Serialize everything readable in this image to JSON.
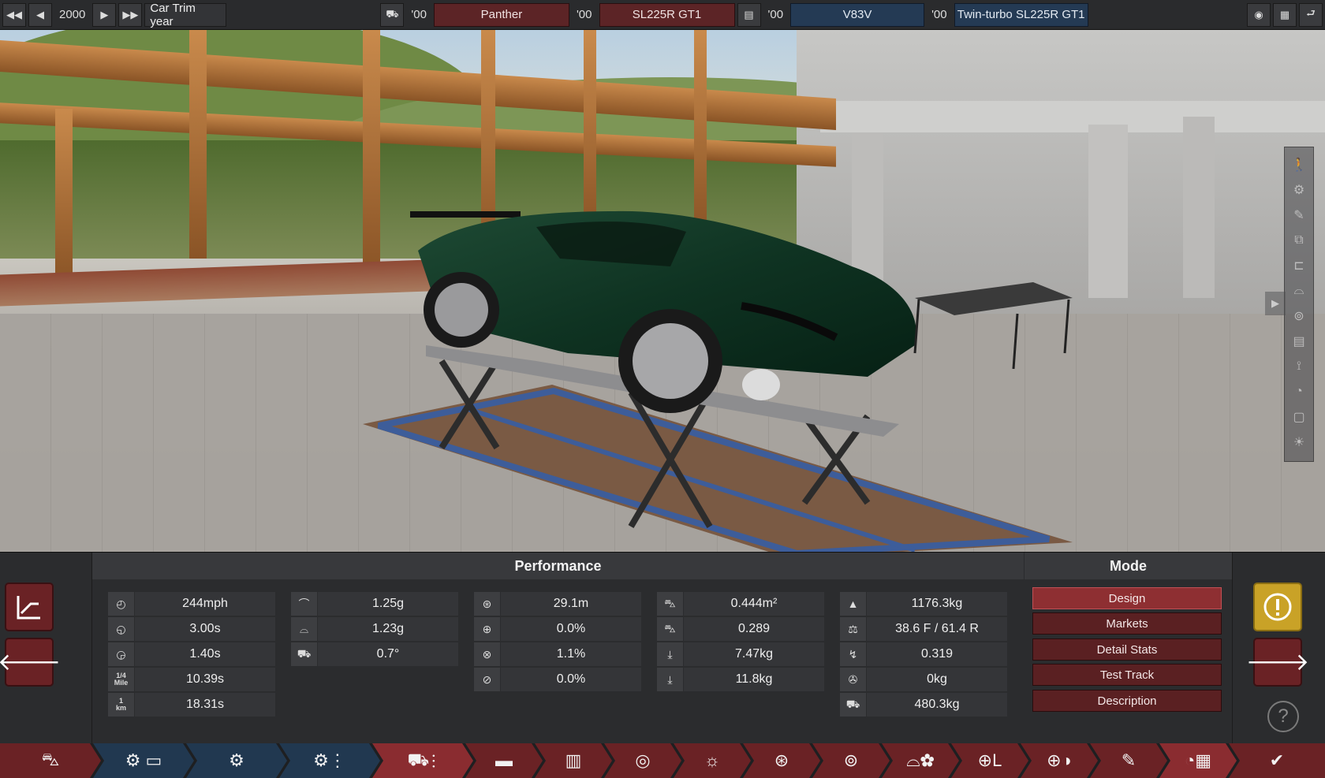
{
  "topbar": {
    "year": "2000",
    "year_label": "Car Trim year",
    "model_year": "'00",
    "model_name": "Panther",
    "trim_year": "'00",
    "trim_name": "SL225R GT1",
    "engine_year": "'00",
    "engine_name": "V83V",
    "variant_year": "'00",
    "variant_name": "Twin-turbo SL225R GT1"
  },
  "panel": {
    "performance_title": "Performance",
    "mode_title": "Mode"
  },
  "stats": {
    "col1": [
      {
        "icon": "speedometer-icon",
        "value": "244mph"
      },
      {
        "icon": "acceleration-icon",
        "value": "3.00s"
      },
      {
        "icon": "gauge-icon",
        "value": "1.40s"
      },
      {
        "icon": "quarter-mile-icon",
        "label_top": "1/4",
        "label_bottom": "Mile",
        "value": "10.39s"
      },
      {
        "icon": "km-icon",
        "label_top": "1",
        "label_bottom": "km",
        "value": "18.31s"
      }
    ],
    "col2": [
      {
        "icon": "corner-grip-icon",
        "value": "1.25g"
      },
      {
        "icon": "corner-grip-alt-icon",
        "value": "1.23g"
      },
      {
        "icon": "body-roll-icon",
        "value": "0.7°"
      }
    ],
    "col3": [
      {
        "icon": "brake-disc-icon",
        "value": "29.1m"
      },
      {
        "icon": "brake-fade-icon",
        "value": "0.0%"
      },
      {
        "icon": "brake-cool-icon",
        "value": "1.1%"
      },
      {
        "icon": "brake-wear-icon",
        "value": "0.0%"
      }
    ],
    "col4": [
      {
        "icon": "frontal-area-icon",
        "value": "0.444m²"
      },
      {
        "icon": "drag-coefficient-icon",
        "value": "0.289"
      },
      {
        "icon": "downforce-front-icon",
        "value": "7.47kg"
      },
      {
        "icon": "downforce-rear-icon",
        "value": "11.8kg"
      }
    ],
    "col5": [
      {
        "icon": "weight-icon",
        "value": "1176.3kg"
      },
      {
        "icon": "weight-distribution-icon",
        "value": "38.6 F / 61.4 R"
      },
      {
        "icon": "lift-icon",
        "value": "0.319"
      },
      {
        "icon": "tools-icon",
        "value": "0kg"
      },
      {
        "icon": "towing-icon",
        "value": "480.3kg"
      }
    ]
  },
  "mode": {
    "design": "Design",
    "markets": "Markets",
    "detail_stats": "Detail Stats",
    "test_track": "Test Track",
    "description": "Description"
  },
  "colors": {
    "accent_red": "#6a2225",
    "accent_blue": "#213850",
    "warning_yellow": "#c9a227"
  }
}
